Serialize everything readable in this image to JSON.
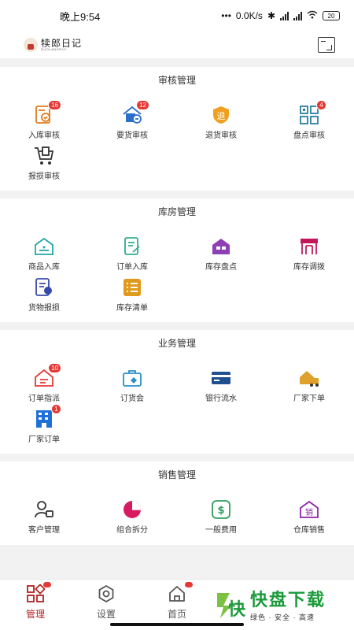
{
  "status": {
    "time": "晚上9:54",
    "speed": "0.0K/s",
    "net1": "HD",
    "net2": "HD",
    "battery": "20"
  },
  "app": {
    "logo_cn": "犊郎日记",
    "logo_en": "DUOLANGRIJI"
  },
  "sections": [
    {
      "title": "审核管理",
      "items": [
        {
          "label": "入库审核",
          "badge": "16",
          "icon": "inbound-review-icon",
          "color": "#e07b1f"
        },
        {
          "label": "要货审核",
          "badge": "12",
          "icon": "request-review-icon",
          "color": "#2a6fc9"
        },
        {
          "label": "退货审核",
          "badge": "",
          "icon": "return-review-icon",
          "color": "#f0a020",
          "glyph": "退"
        },
        {
          "label": "盘点审核",
          "badge": "4",
          "icon": "stocktake-review-icon",
          "color": "#2a7f9e"
        },
        {
          "label": "报损审核",
          "badge": "",
          "icon": "loss-review-icon",
          "color": "#333333"
        }
      ]
    },
    {
      "title": "库房管理",
      "items": [
        {
          "label": "商品入库",
          "badge": "",
          "icon": "goods-inbound-icon",
          "color": "#26a5a5"
        },
        {
          "label": "订单入库",
          "badge": "",
          "icon": "order-inbound-icon",
          "color": "#2cae8f"
        },
        {
          "label": "库存盘点",
          "badge": "",
          "icon": "inventory-count-icon",
          "color": "#8e3fb5"
        },
        {
          "label": "库存调拨",
          "badge": "",
          "icon": "inventory-transfer-icon",
          "color": "#c2185b"
        },
        {
          "label": "货物报损",
          "badge": "",
          "icon": "goods-loss-icon",
          "color": "#3949ab"
        },
        {
          "label": "库存清单",
          "badge": "",
          "icon": "inventory-list-icon",
          "color": "#e09a1c"
        }
      ]
    },
    {
      "title": "业务管理",
      "items": [
        {
          "label": "订单指派",
          "badge": "10",
          "icon": "order-assign-icon",
          "color": "#e53935"
        },
        {
          "label": "订货会",
          "badge": "",
          "icon": "order-fair-icon",
          "color": "#2a8fc9"
        },
        {
          "label": "银行流水",
          "badge": "",
          "icon": "bank-statement-icon",
          "color": "#1f4f8f"
        },
        {
          "label": "厂家下单",
          "badge": "",
          "icon": "factory-order-icon",
          "color": "#e0a02c"
        },
        {
          "label": "厂家订单",
          "badge": "1",
          "icon": "factory-orders-icon",
          "color": "#1e6fd9"
        }
      ]
    },
    {
      "title": "销售管理",
      "items": [
        {
          "label": "客户管理",
          "badge": "",
          "icon": "customer-manage-icon",
          "color": "#333333"
        },
        {
          "label": "组合拆分",
          "badge": "",
          "icon": "combo-split-icon",
          "color": "#d81b60"
        },
        {
          "label": "一般费用",
          "badge": "",
          "icon": "general-expense-icon",
          "color": "#2e9e5b"
        },
        {
          "label": "仓库销售",
          "badge": "",
          "icon": "warehouse-sales-icon",
          "color": "#8e24aa",
          "glyph": "销"
        }
      ]
    }
  ],
  "tabs": [
    {
      "label": "管理",
      "icon": "manage-grid-icon",
      "active": true,
      "dot": true
    },
    {
      "label": "设置",
      "icon": "settings-gear-icon",
      "active": false,
      "dot": false
    },
    {
      "label": "首页",
      "icon": "home-icon",
      "active": false,
      "dot": true
    }
  ],
  "watermark": {
    "title": "快盘下载",
    "subtitle": "绿色 · 安全 · 高速",
    "glyph": "快"
  },
  "colors": {
    "accent": "#b22222",
    "badge": "#e53935",
    "watermark": "#1a9b3a"
  }
}
